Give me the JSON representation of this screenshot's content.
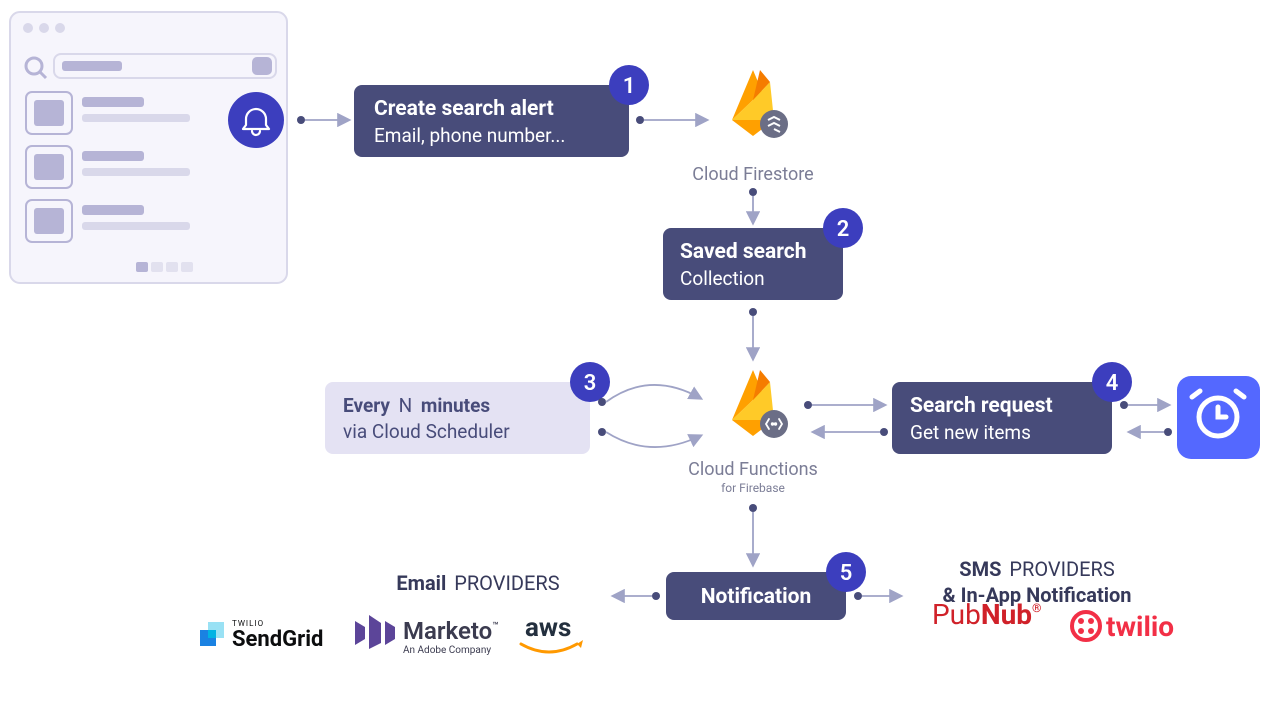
{
  "steps": [
    {
      "num": "1",
      "title": "Create search alert",
      "sub": "Email, phone number..."
    },
    {
      "num": "2",
      "title": "Saved search",
      "sub": "Collection"
    },
    {
      "num": "3",
      "title_a": "Every",
      "title_n": "N",
      "title_b": "minutes",
      "sub": "via Cloud Scheduler"
    },
    {
      "num": "4",
      "title": "Search request",
      "sub": "Get new items"
    },
    {
      "num": "5",
      "title": "Notification"
    }
  ],
  "services": {
    "firestore": "Cloud Firestore",
    "functions": "Cloud Functions",
    "functions_sub": "for Firebase"
  },
  "providers": {
    "email_head_a": "Email",
    "email_head_b": "PROVIDERS",
    "sms_head_a": "SMS",
    "sms_head_b": "PROVIDERS",
    "sms_head_c": "& In-App Notification",
    "sendgrid": "SendGrid",
    "sendgrid_tag": "TWILIO",
    "marketo": "Marketo",
    "marketo_tag": "An Adobe Company",
    "marketo_tm": "™",
    "aws": "aws",
    "pubnub": "PubNub",
    "pubnub_r": "®",
    "twilio": "twilio"
  }
}
